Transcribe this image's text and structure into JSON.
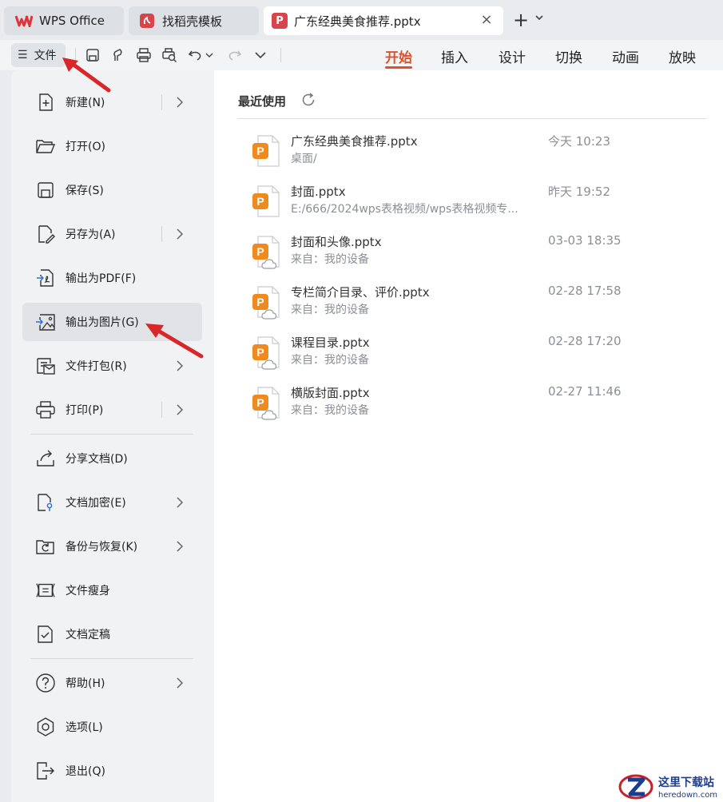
{
  "tabs": [
    {
      "label": "WPS Office",
      "icon": "wps-logo-icon"
    },
    {
      "label": "找稻壳模板",
      "icon": "docer-logo-icon"
    },
    {
      "label": "广东经典美食推荐.pptx",
      "icon": "pptx-logo-icon",
      "active": true
    }
  ],
  "toolbar": {
    "file_label": "文件",
    "icons": [
      "save-icon",
      "format-painter-icon",
      "print-icon",
      "print-preview-icon",
      "undo-icon",
      "redo-icon",
      "more-icon"
    ]
  },
  "ribbon": {
    "tabs": [
      "开始",
      "插入",
      "设计",
      "切换",
      "动画",
      "放映"
    ],
    "active": "开始",
    "accent": "#d9532f"
  },
  "menu": {
    "items": [
      {
        "label": "新建(N)",
        "icon": "new-file-icon",
        "submenu": true
      },
      {
        "label": "打开(O)",
        "icon": "open-folder-icon",
        "submenu": false
      },
      {
        "label": "保存(S)",
        "icon": "save-icon",
        "submenu": false
      },
      {
        "label": "另存为(A)",
        "icon": "save-as-icon",
        "submenu": true
      },
      {
        "label": "输出为PDF(F)",
        "icon": "export-pdf-icon",
        "submenu": false
      },
      {
        "label": "输出为图片(G)",
        "icon": "export-image-icon",
        "submenu": false,
        "highlighted": true
      },
      {
        "label": "文件打包(R)",
        "icon": "package-icon",
        "submenu": true
      },
      {
        "label": "打印(P)",
        "icon": "print-icon",
        "submenu": true
      },
      {
        "label": "分享文档(D)",
        "icon": "share-icon",
        "submenu": false
      },
      {
        "label": "文档加密(E)",
        "icon": "encrypt-icon",
        "submenu": true
      },
      {
        "label": "备份与恢复(K)",
        "icon": "backup-icon",
        "submenu": true
      },
      {
        "label": "文件瘦身",
        "icon": "slim-icon",
        "submenu": false
      },
      {
        "label": "文档定稿",
        "icon": "finalize-icon",
        "submenu": false
      },
      {
        "label": "帮助(H)",
        "icon": "help-icon",
        "submenu": true
      },
      {
        "label": "选项(L)",
        "icon": "options-icon",
        "submenu": false
      },
      {
        "label": "退出(Q)",
        "icon": "exit-icon",
        "submenu": false
      }
    ]
  },
  "recent": {
    "title": "最近使用",
    "files": [
      {
        "name": "广东经典美食推荐.pptx",
        "location": "桌面/",
        "time": "今天 10:23",
        "cloud": false
      },
      {
        "name": "封面.pptx",
        "location": "E:/666/2024wps表格视频/wps表格视频专...",
        "time": "昨天 19:52",
        "cloud": false
      },
      {
        "name": "封面和头像.pptx",
        "location": "来自：我的设备",
        "time": "03-03 18:35",
        "cloud": true
      },
      {
        "name": "专栏简介目录、评价.pptx",
        "location": "来自：我的设备",
        "time": "02-28 17:58",
        "cloud": true
      },
      {
        "name": "课程目录.pptx",
        "location": "来自：我的设备",
        "time": "02-28 17:20",
        "cloud": true
      },
      {
        "name": "横版封面.pptx",
        "location": "来自：我的设备",
        "time": "02-27 11:46",
        "cloud": true
      }
    ]
  },
  "watermark": {
    "cn": "这里下载站",
    "en": "heredown.com"
  },
  "colors": {
    "pptx_orange": "#ef8a1e",
    "arrow_red": "#d9262b"
  }
}
